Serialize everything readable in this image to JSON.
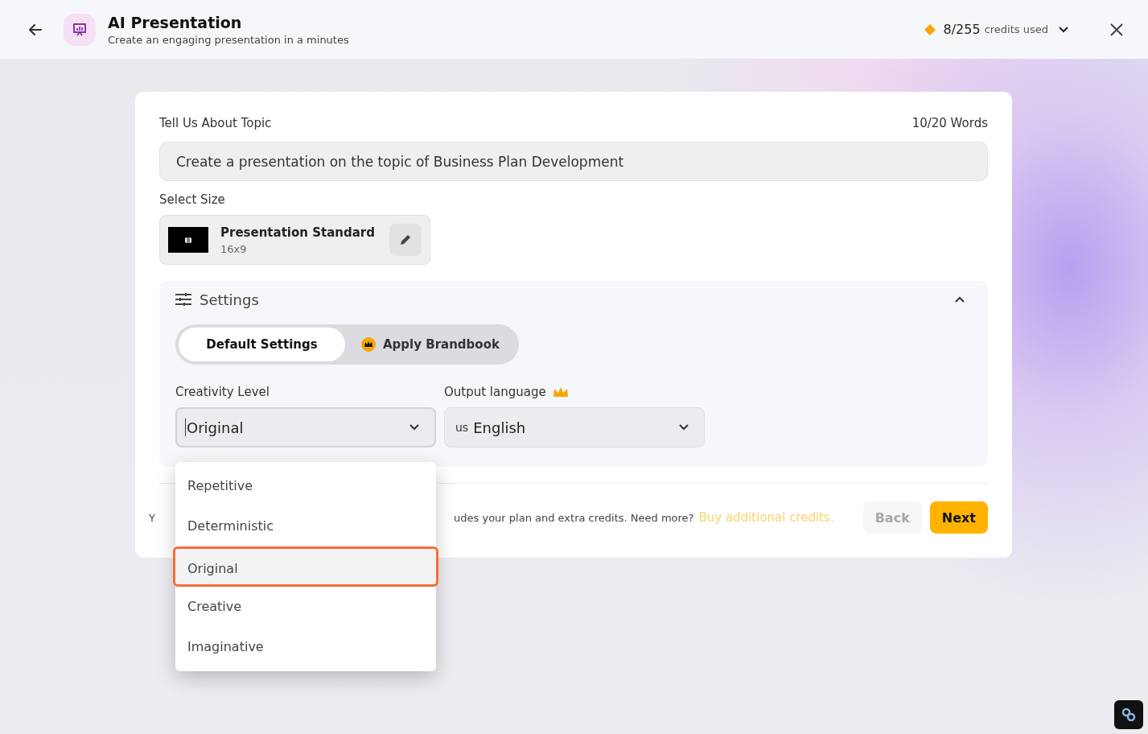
{
  "header": {
    "title": "AI Presentation",
    "subtitle": "Create an engaging presentation in a minutes",
    "credits_count": "8/255",
    "credits_label": "credits used"
  },
  "topic": {
    "label": "Tell Us About Topic",
    "word_count": "10/20 Words",
    "value": "Create a presentation on the topic of Business Plan Development"
  },
  "size": {
    "label": "Select Size",
    "name": "Presentation Standard",
    "ratio": "16x9"
  },
  "settings": {
    "title": "Settings",
    "expanded": true,
    "modes": [
      {
        "label": "Default Settings",
        "selected": true,
        "premium": false
      },
      {
        "label": "Apply Brandbook",
        "selected": false,
        "premium": true
      }
    ],
    "creativity": {
      "label": "Creativity Level",
      "value": "Original"
    },
    "language": {
      "label": "Output language",
      "premium": true,
      "flag": "us",
      "value": "English"
    }
  },
  "dropdown": {
    "options": [
      {
        "label": "Repetitive",
        "selected": false
      },
      {
        "label": "Deterministic",
        "selected": false
      },
      {
        "label": "Original",
        "selected": true
      },
      {
        "label": "Creative",
        "selected": false
      },
      {
        "label": "Imaginative",
        "selected": false
      }
    ]
  },
  "footer": {
    "note_start": "Y",
    "note_end": "udes your plan and extra credits. Need more?",
    "link": "Buy additional credits.",
    "back": {
      "label": "Back",
      "disabled": true
    },
    "next": {
      "label": "Next",
      "disabled": false
    }
  }
}
